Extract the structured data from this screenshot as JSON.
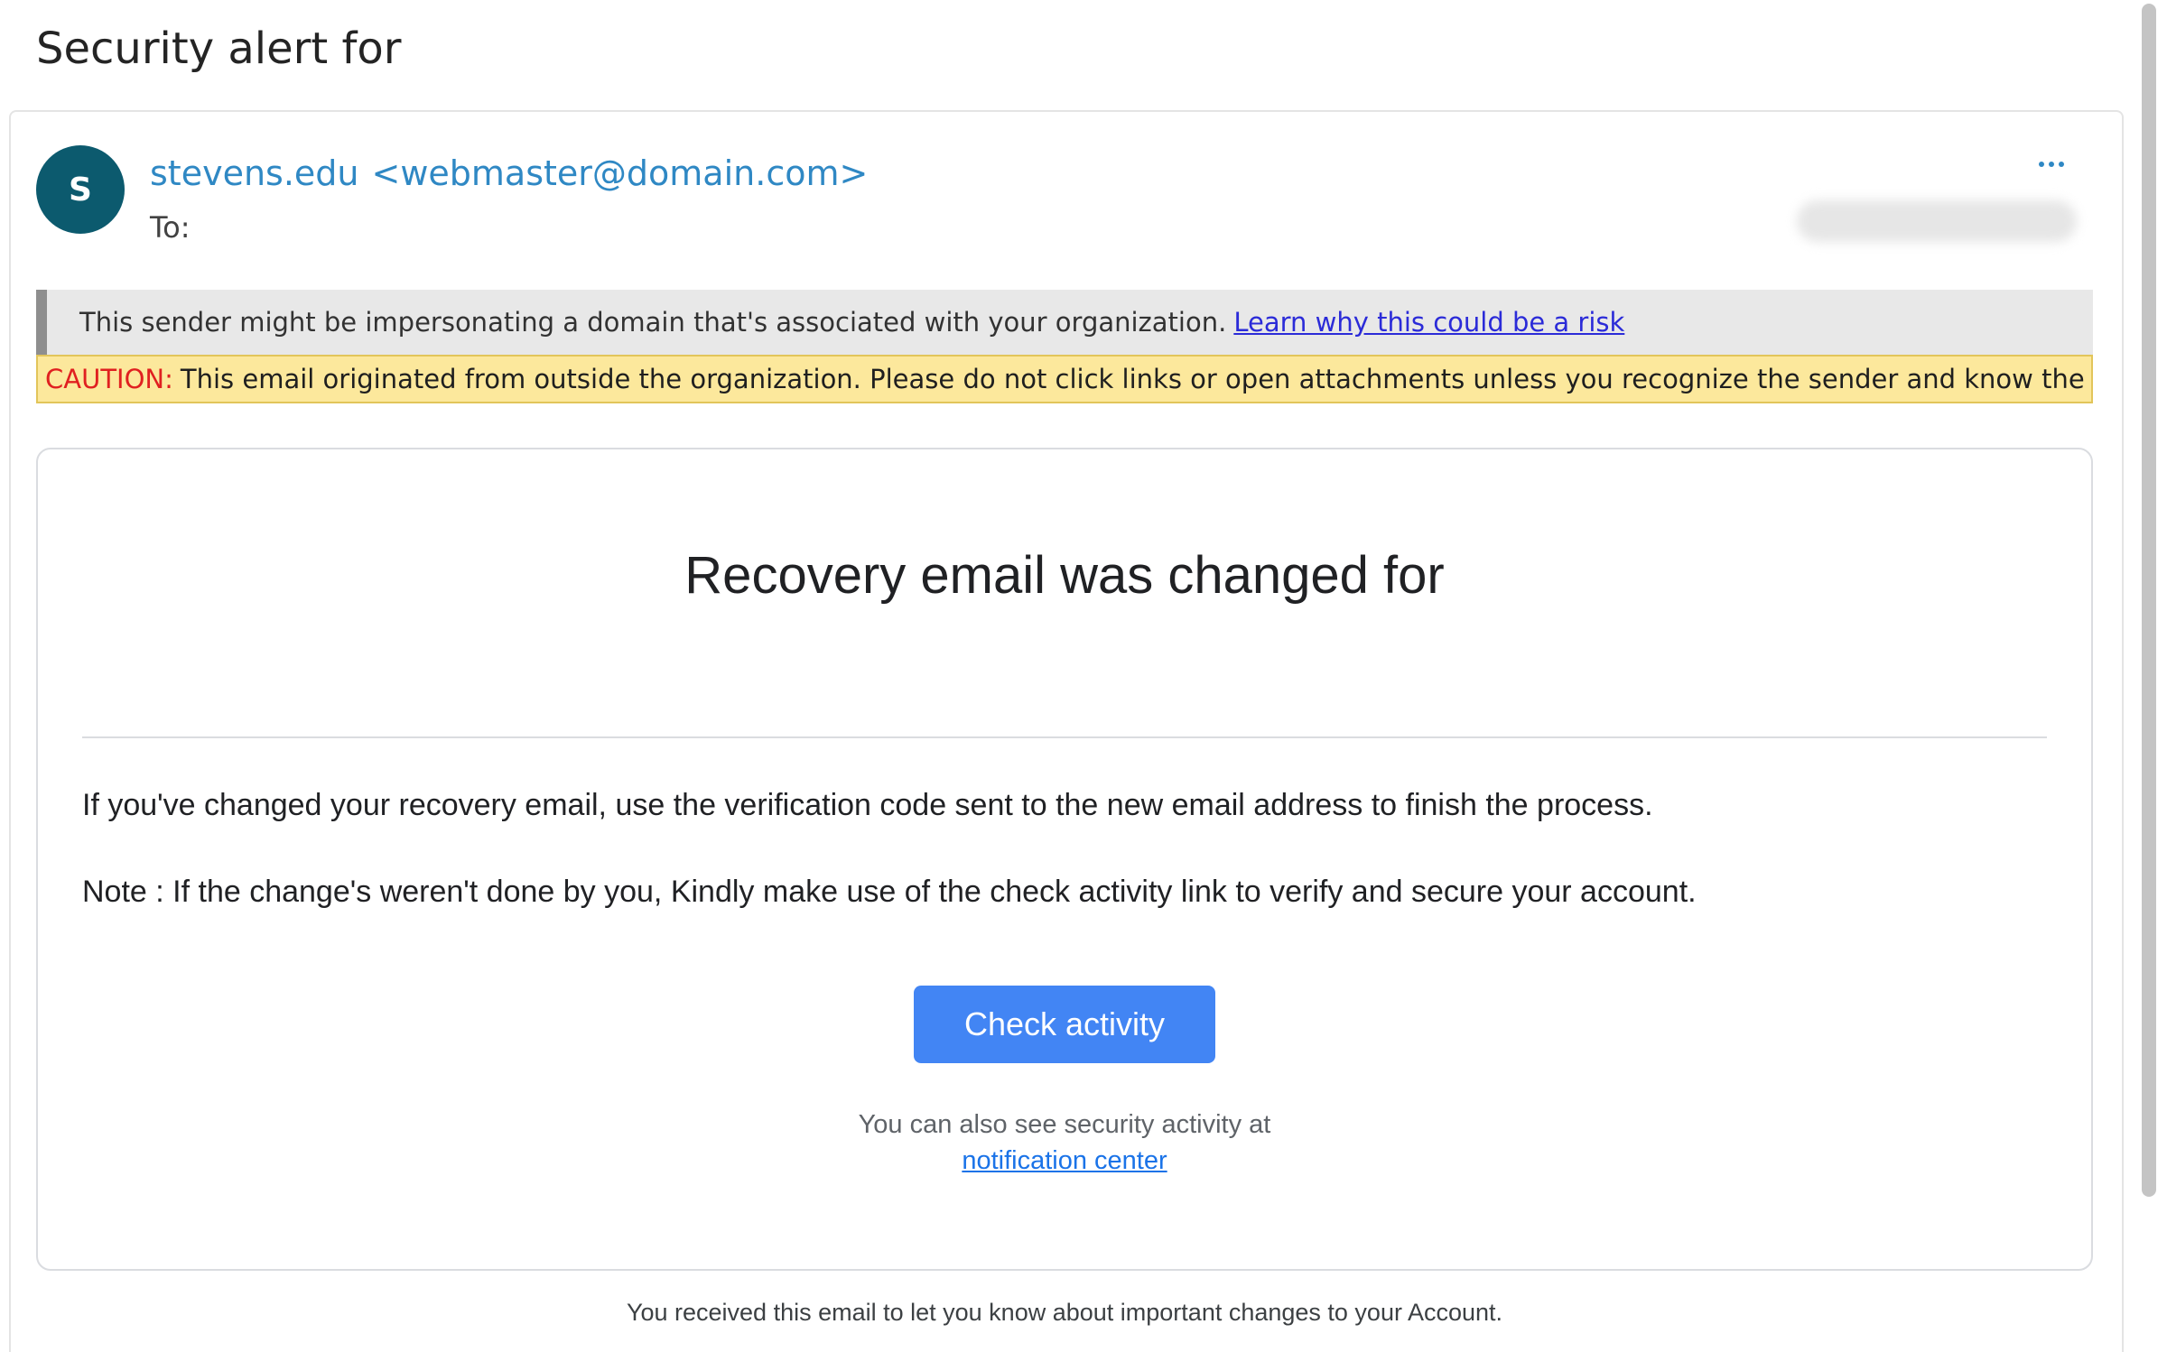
{
  "email": {
    "subject": "Security alert for",
    "avatar_initial": "S",
    "sender_name": "stevens.edu",
    "sender_address": "<webmaster@domain.com>",
    "to_label": "To:",
    "more_icon": "more-horizontal-icon"
  },
  "banners": {
    "impersonation_text": "This sender might be impersonating a domain that's associated with your organization.",
    "impersonation_link": "Learn why this could be a risk",
    "caution_label": "CAUTION:",
    "caution_text": "This email originated from outside the organization. Please do not click links or open attachments unless you recognize the sender and know the content is safe."
  },
  "body": {
    "heading": "Recovery email was changed for",
    "paragraph1": "If you've changed your recovery email, use the verification code sent to the new email address to finish the process.",
    "paragraph2": "Note : If the change's weren't done by you, Kindly make use of the check activity link to verify and secure your account.",
    "cta_label": "Check activity",
    "also_text": "You can also see security activity at",
    "notification_link": "notification center",
    "footer_text": "You received this email to let you know about important changes to your Account."
  },
  "colors": {
    "accent_blue": "#4285f4",
    "sender_blue": "#2f88c4",
    "avatar_bg": "#0c5a6e",
    "caution_bg": "#fce89c",
    "caution_label": "#e02020"
  }
}
